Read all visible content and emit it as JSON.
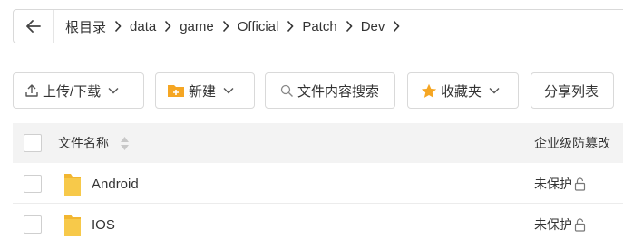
{
  "breadcrumb": {
    "back_icon": "arrow-left-icon",
    "items": [
      "根目录",
      "data",
      "game",
      "Official",
      "Patch",
      "Dev"
    ]
  },
  "toolbar": {
    "upload_download": "上传/下载",
    "new": "新建",
    "search": "文件内容搜索",
    "favorites": "收藏夹",
    "share_list": "分享列表",
    "accent_color": "#f5a623"
  },
  "table": {
    "headers": {
      "name": "文件名称",
      "protection": "企业级防篡改"
    },
    "rows": [
      {
        "name": "Android",
        "protection": "未保护"
      },
      {
        "name": "IOS",
        "protection": "未保护"
      }
    ],
    "folder_color": "#f7c94a"
  }
}
